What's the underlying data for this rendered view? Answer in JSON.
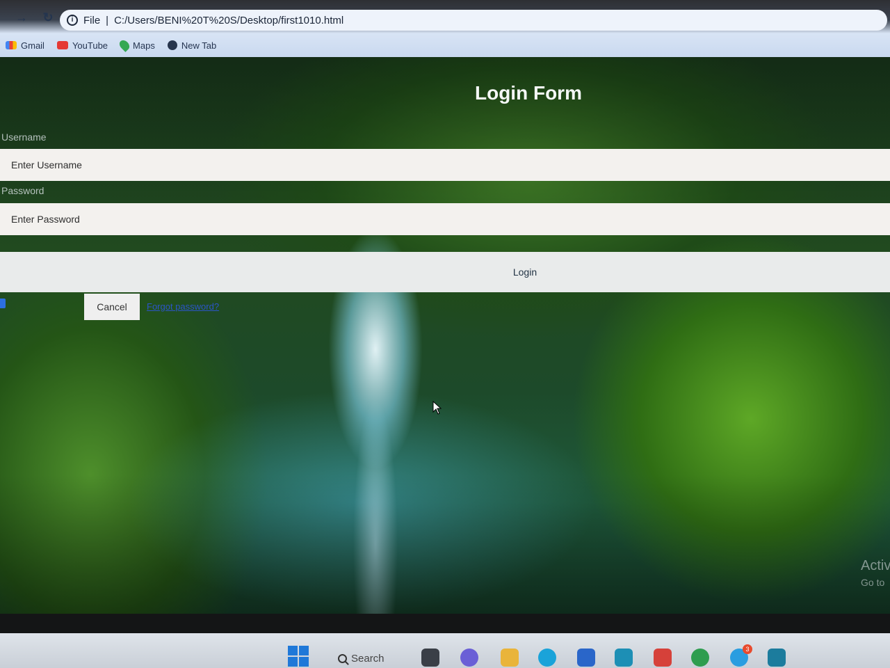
{
  "browser": {
    "nav": {
      "back_icon": "←",
      "forward_icon": "→",
      "reload_icon": "↻"
    },
    "address": {
      "info_icon": "i",
      "file_label": "File",
      "url": "C:/Users/BENI%20T%20S/Desktop/first1010.html"
    },
    "bookmarks": [
      {
        "label": "Gmail",
        "icon": "gmail-icon"
      },
      {
        "label": "YouTube",
        "icon": "youtube-icon"
      },
      {
        "label": "Maps",
        "icon": "maps-icon"
      },
      {
        "label": "New Tab",
        "icon": "new-tab-icon"
      }
    ]
  },
  "page": {
    "title": "Login Form",
    "username_label": "Username",
    "username_placeholder": "Enter Username",
    "password_label": "Password",
    "password_placeholder": "Enter Password",
    "login_button": "Login",
    "cancel_button": "Cancel",
    "forgot_link": "Forgot password?",
    "watermark_main": "Activ",
    "watermark_sub": "Go to"
  },
  "taskbar": {
    "search_label": "Search",
    "badge_telegram": "3",
    "colors": {
      "start": "#1f78d8",
      "accent": "#e84a2d"
    }
  }
}
